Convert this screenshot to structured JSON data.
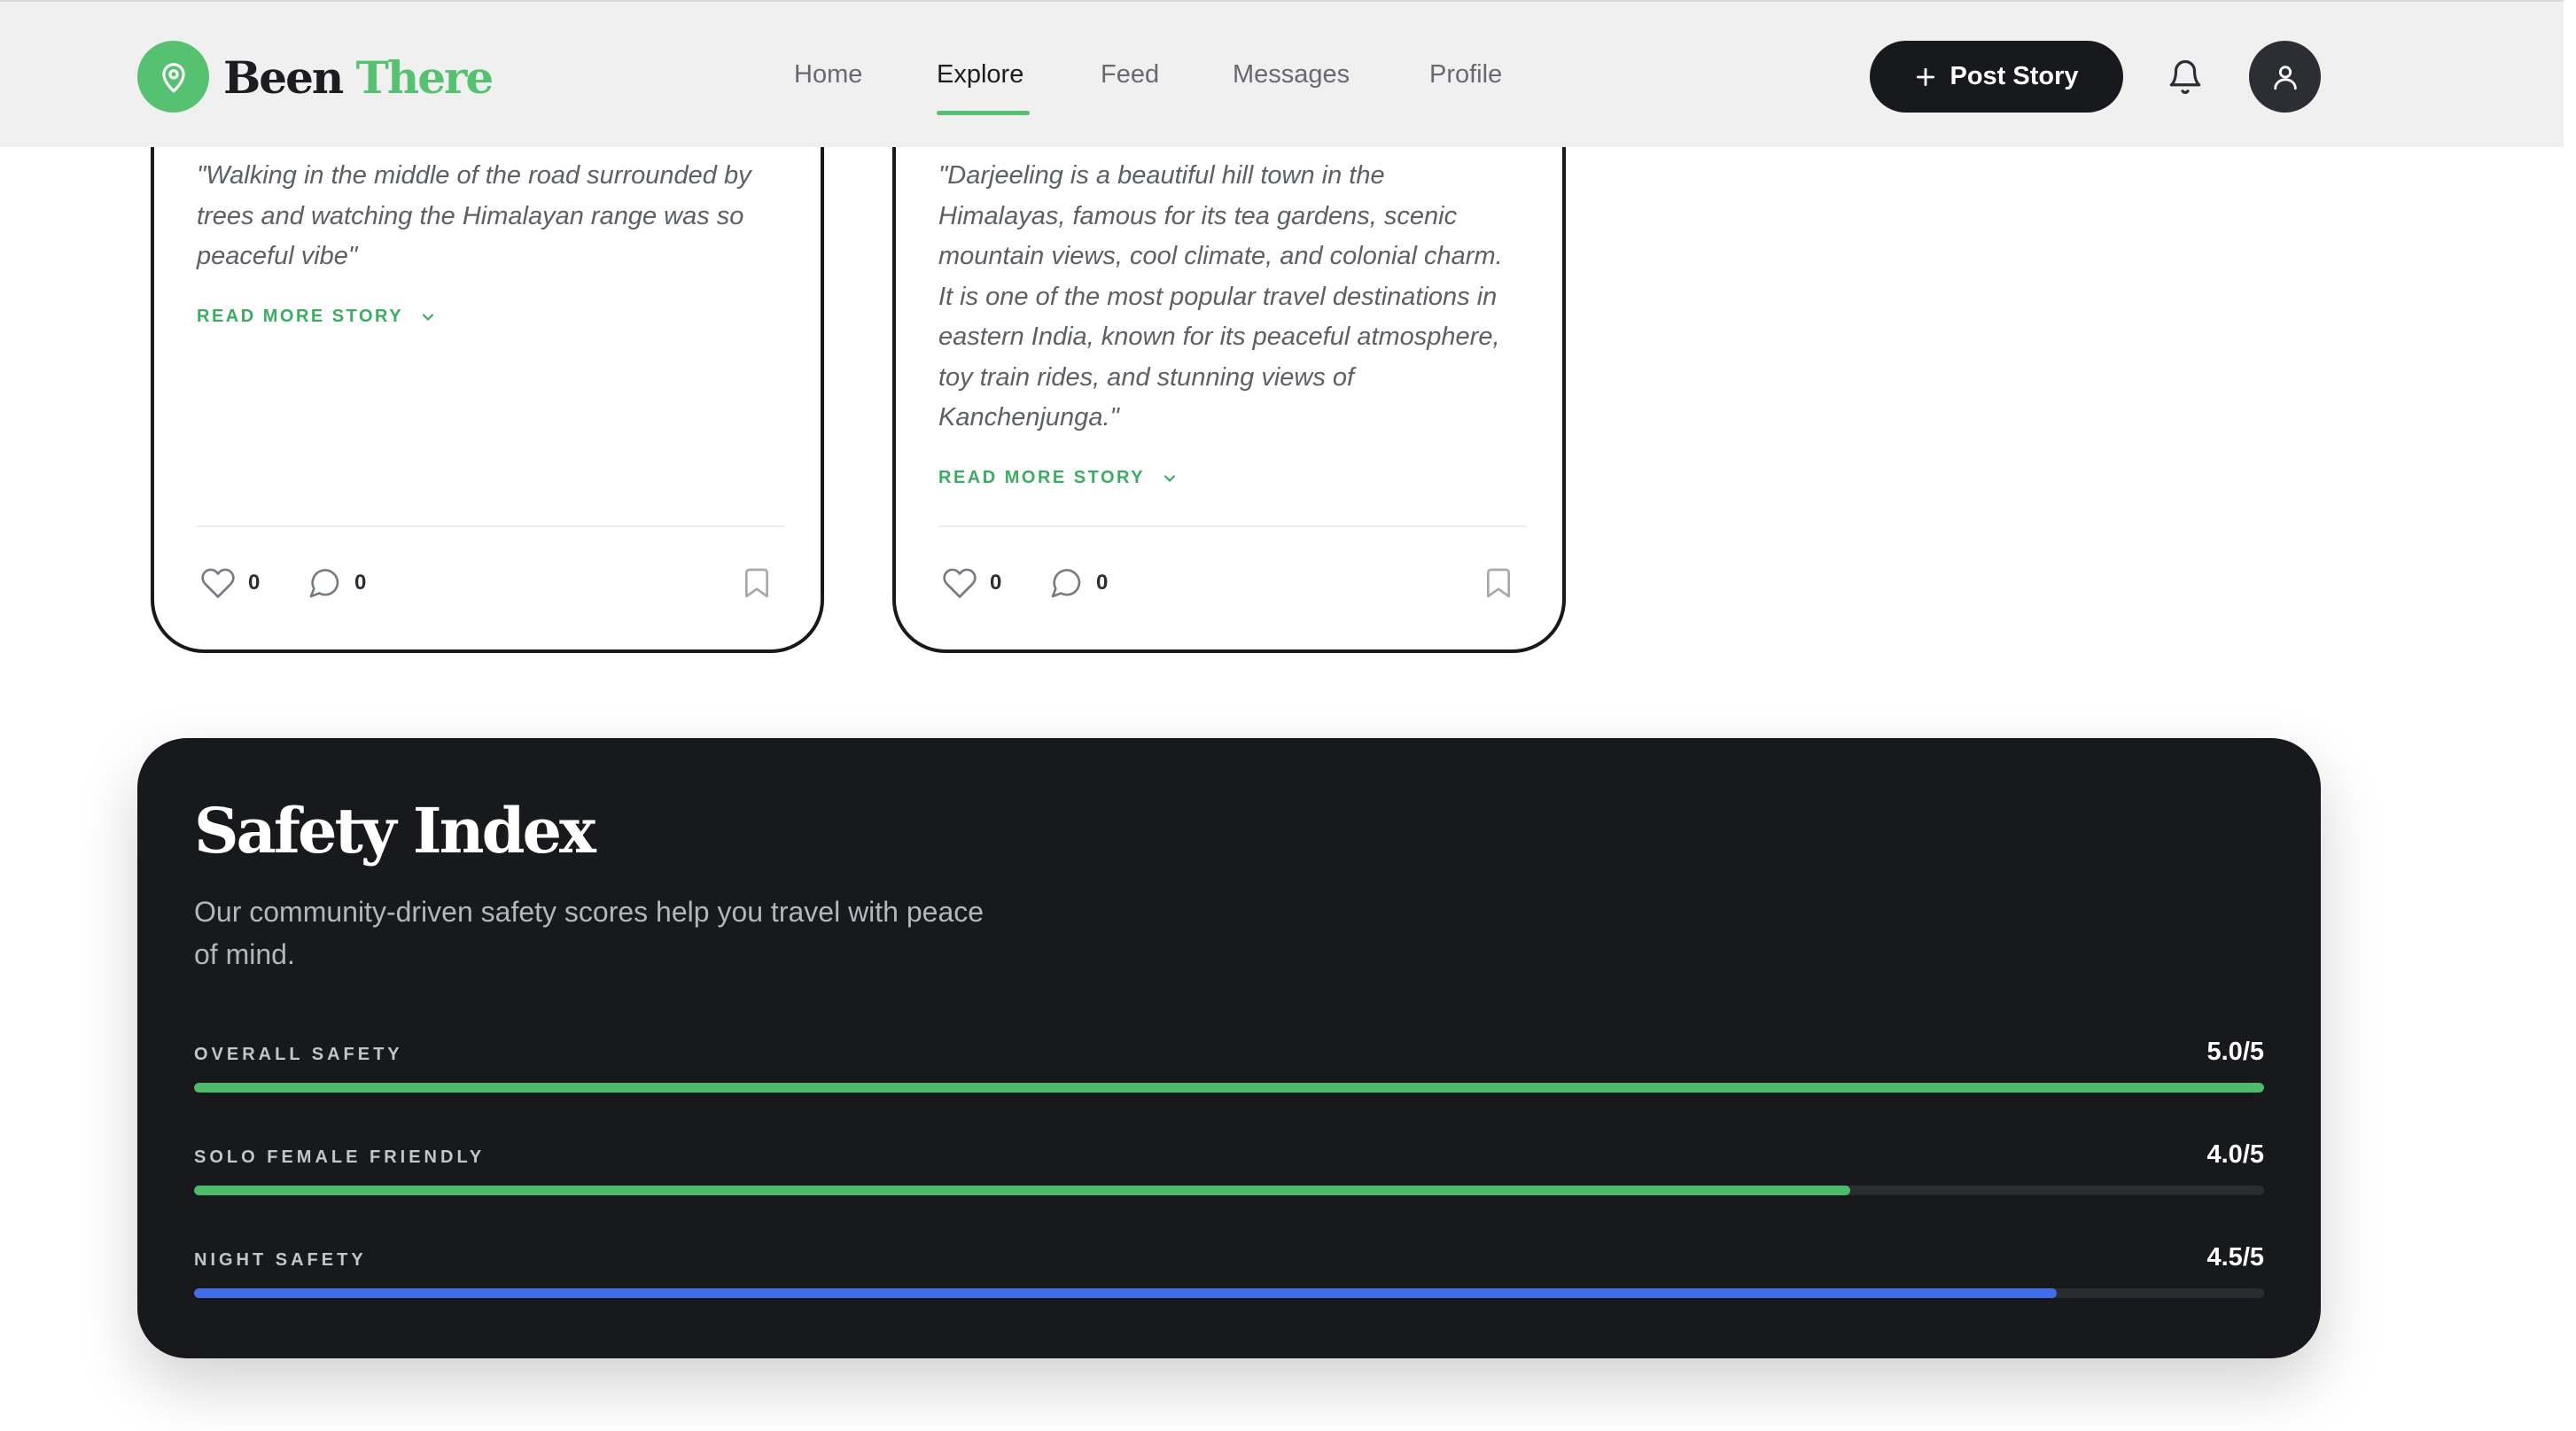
{
  "navbar": {
    "brand_word1": "Been",
    "brand_word2": "There",
    "links": [
      {
        "label": "Home",
        "active": false
      },
      {
        "label": "Explore",
        "active": true
      },
      {
        "label": "Feed",
        "active": false
      },
      {
        "label": "Messages",
        "active": false
      },
      {
        "label": "Profile",
        "active": false
      }
    ],
    "post_button_label": "Post Story",
    "icons": [
      "map-pin-icon",
      "plus-icon",
      "bell-icon",
      "user-icon"
    ]
  },
  "stories": [
    {
      "quote": "\"Walking in the middle of the road surrounded by trees and watching the Himalayan range was so peaceful vibe\"",
      "read_more": "READ MORE STORY",
      "likes": "0",
      "comments": "0"
    },
    {
      "quote": "\"Darjeeling is a beautiful hill town in the Himalayas, famous for its tea gardens, scenic mountain views, cool climate, and colonial charm. It is one of the most popular travel destinations in eastern India, known for its peaceful atmosphere, toy train rides, and stunning views of Kanchenjunga.\"",
      "read_more": "READ MORE STORY",
      "likes": "0",
      "comments": "0"
    }
  ],
  "safety": {
    "title": "Safety Index",
    "description": "Our community-driven safety scores help you travel with peace of mind.",
    "metrics": [
      {
        "label": "OVERALL SAFETY",
        "value": "5.0/5",
        "score": 5.0,
        "max": 5,
        "color": "#4cbb6c"
      },
      {
        "label": "SOLO FEMALE FRIENDLY",
        "value": "4.0/5",
        "score": 4.0,
        "max": 5,
        "color": "#4cbb6c"
      },
      {
        "label": "NIGHT SAFETY",
        "value": "4.5/5",
        "score": 4.5,
        "max": 5,
        "color": "#3f6ee6"
      }
    ]
  },
  "colors": {
    "brand_green": "#56c271",
    "link_green": "#3aad62",
    "dark": "#17191d",
    "panel": "#18191d"
  }
}
